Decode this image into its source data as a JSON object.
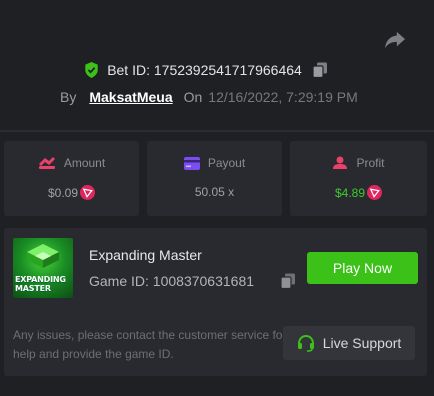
{
  "bet": {
    "label": "Bet ID:",
    "id": "1752392541717966464",
    "by_label": "By",
    "user": "MaksatMeua",
    "on_label": "On",
    "date": "12/16/2022, 7:29:19 PM"
  },
  "stats": {
    "amount": {
      "label": "Amount",
      "value": "$0.09"
    },
    "payout": {
      "label": "Payout",
      "value": "50.05 x"
    },
    "profit": {
      "label": "Profit",
      "value": "$4.89"
    }
  },
  "game": {
    "name": "Expanding Master",
    "id_label": "Game ID:",
    "id": "1008370631681",
    "thumb_line1": "EXPANDING",
    "thumb_line2": "MASTER",
    "play_label": "Play Now"
  },
  "support": {
    "notice": "Any issues, please contact the customer service for help and provide the game ID.",
    "button_label": "Live Support"
  },
  "colors": {
    "accent_green": "#3bc117",
    "profit_green": "#3dcb2e",
    "amount_icon": "#e94167",
    "payout_icon": "#7b4ef0",
    "profit_icon": "#e94167",
    "tron_red": "#e0265f"
  },
  "icons": {
    "share": "share-icon",
    "verified": "shield-check-icon",
    "copy": "copy-icon",
    "amount": "bet-amount-icon",
    "payout": "card-payout-icon",
    "profit": "profit-icon",
    "currency": "tron-icon",
    "support": "headset-icon"
  }
}
